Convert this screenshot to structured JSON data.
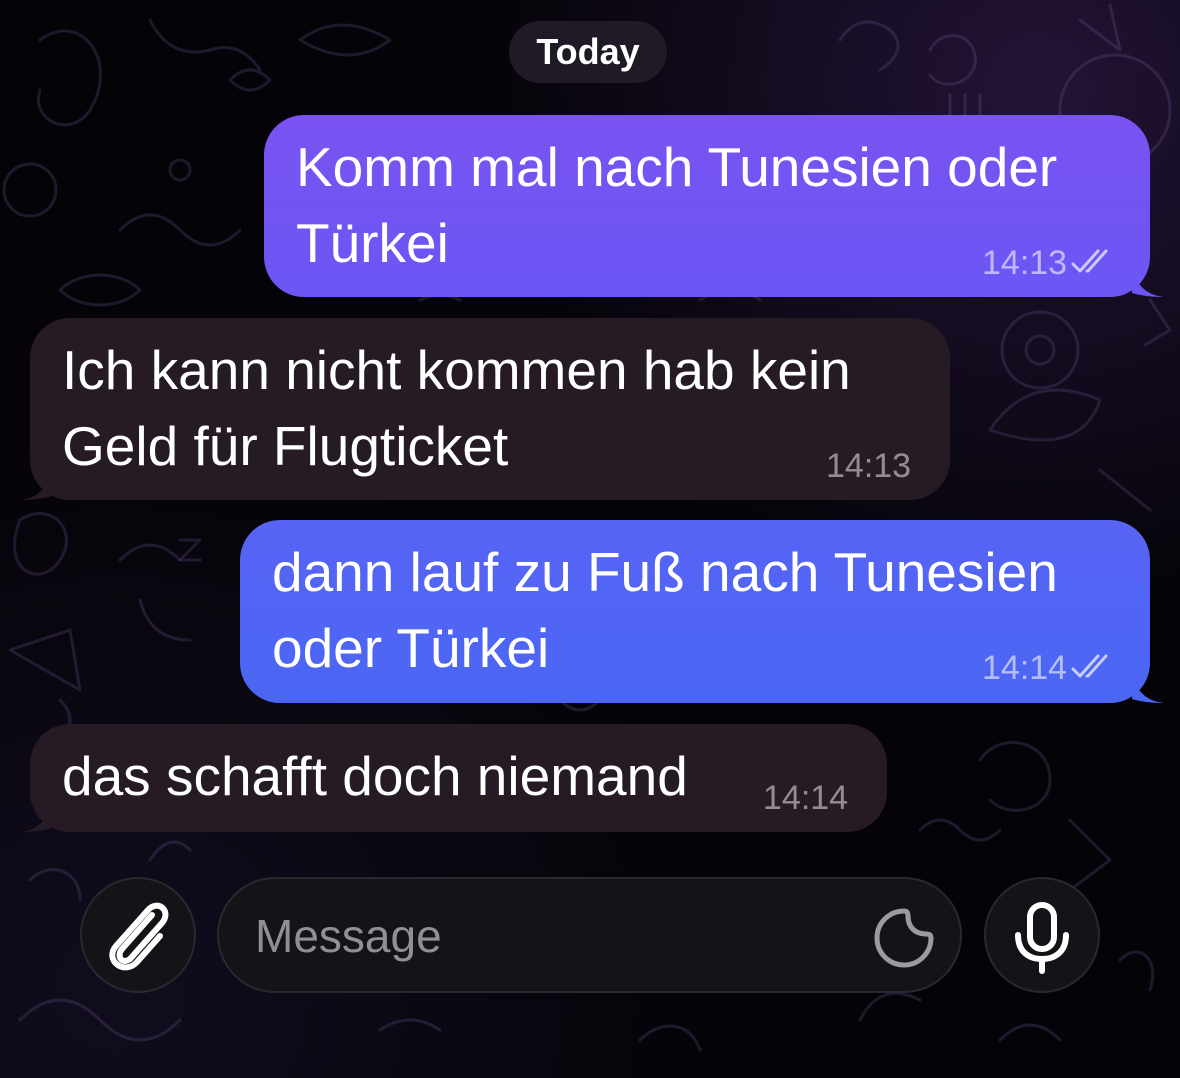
{
  "chat": {
    "date_label": "Today",
    "messages": [
      {
        "direction": "outgoing",
        "lines": [
          "Komm mal nach Tunesien oder",
          "Türkei"
        ],
        "time": "14:13",
        "status_icon": "double-check-icon"
      },
      {
        "direction": "incoming",
        "lines": [
          "Ich kann nicht kommen hab kein",
          "Geld für Flugticket"
        ],
        "time": "14:13"
      },
      {
        "direction": "outgoing",
        "lines": [
          "dann lauf zu Fuß nach Tunesien",
          "oder Türkei"
        ],
        "time": "14:14",
        "status_icon": "double-check-icon"
      },
      {
        "direction": "incoming",
        "lines": [
          "das schafft doch niemand"
        ],
        "time": "14:14"
      }
    ]
  },
  "composer": {
    "placeholder": "Message",
    "value": "",
    "attach_icon": "paperclip-icon",
    "sticker_icon": "sticker-icon",
    "mic_icon": "microphone-icon"
  },
  "colors": {
    "outgoing_bubble_top": "#7a53f2",
    "outgoing_bubble_bottom": "#4a66f3",
    "incoming_bubble": "#261b24",
    "background": "#050308"
  }
}
